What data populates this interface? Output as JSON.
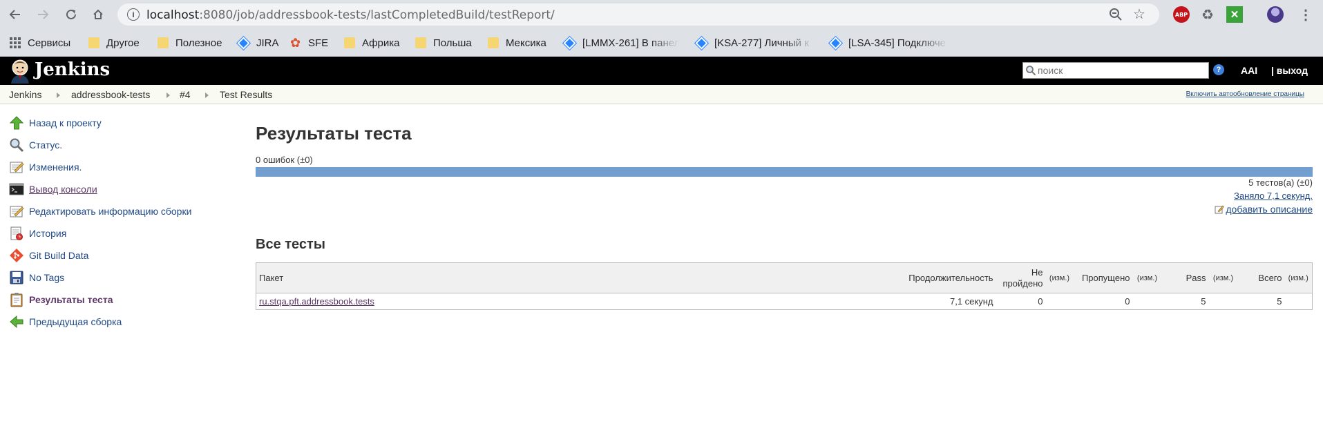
{
  "browser": {
    "url_host": "localhost",
    "url_path": ":8080/job/addressbook-tests/lastCompletedBuild/testReport/",
    "extensions": {
      "abp": "ABP"
    },
    "bookmarks": [
      {
        "label": "Сервисы",
        "icon": "apps-icon"
      },
      {
        "label": "Другое",
        "icon": "folder-icon"
      },
      {
        "label": "Полезное",
        "icon": "folder-icon"
      },
      {
        "label": "JIRA",
        "icon": "jira-icon"
      },
      {
        "label": "SFE",
        "icon": "sfe-icon"
      },
      {
        "label": "Африка",
        "icon": "folder-icon"
      },
      {
        "label": "Польша",
        "icon": "folder-icon"
      },
      {
        "label": "Мексика",
        "icon": "folder-icon"
      },
      {
        "label": "[LMMX-261] В панел",
        "icon": "jira-icon"
      },
      {
        "label": "[KSA-277] Личный к",
        "icon": "jira-icon"
      },
      {
        "label": "[LSA-345] Подключе",
        "icon": "jira-icon"
      }
    ]
  },
  "jenkins": {
    "title": "Jenkins",
    "search_placeholder": "поиск",
    "user": "AAI",
    "logout": "| выход"
  },
  "breadcrumbs": [
    "Jenkins",
    "addressbook-tests",
    "#4",
    "Test Results"
  ],
  "autorefresh": "Включить автообновление страницы",
  "side_tasks": [
    {
      "label": "Назад к проекту",
      "icon": "up-arrow-icon"
    },
    {
      "label": "Статус.",
      "icon": "search-icon"
    },
    {
      "label": "Изменения.",
      "icon": "notepad-icon"
    },
    {
      "label": "Вывод консоли",
      "icon": "terminal-icon"
    },
    {
      "label": "Редактировать информацию сборки",
      "icon": "notepad-icon"
    },
    {
      "label": "История",
      "icon": "history-icon"
    },
    {
      "label": "Git Build Data",
      "icon": "git-icon"
    },
    {
      "label": "No Tags",
      "icon": "save-icon"
    },
    {
      "label": "Результаты теста",
      "icon": "clipboard-icon"
    },
    {
      "label": "Предыдущая сборка",
      "icon": "left-arrow-icon"
    }
  ],
  "report": {
    "title": "Результаты теста",
    "failures": "0 ошибок (±0)",
    "pass_fraction": 1.0,
    "total": "5 тестов(а) (±0)",
    "took": "Заняло 7,1 секунд.",
    "add_description": "добавить описание",
    "all_tests_title": "Все тесты",
    "columns": {
      "package": "Пакет",
      "duration": "Продолжительность",
      "failed_1": "Не",
      "failed_2": "пройдено",
      "delta": "(изм.)",
      "skipped": "Пропущено",
      "pass": "Pass",
      "total": "Всего"
    },
    "rows": [
      {
        "package": "ru.stqa.pft.addressbook.tests",
        "duration": "7,1 секунд",
        "failed": "0",
        "skipped": "0",
        "pass": "5",
        "total": "5"
      }
    ]
  },
  "colors": {
    "jenkins_header": "#000000",
    "pass_bar": "#729fcf",
    "link": "#204a87",
    "visited_link": "#5c3566"
  }
}
